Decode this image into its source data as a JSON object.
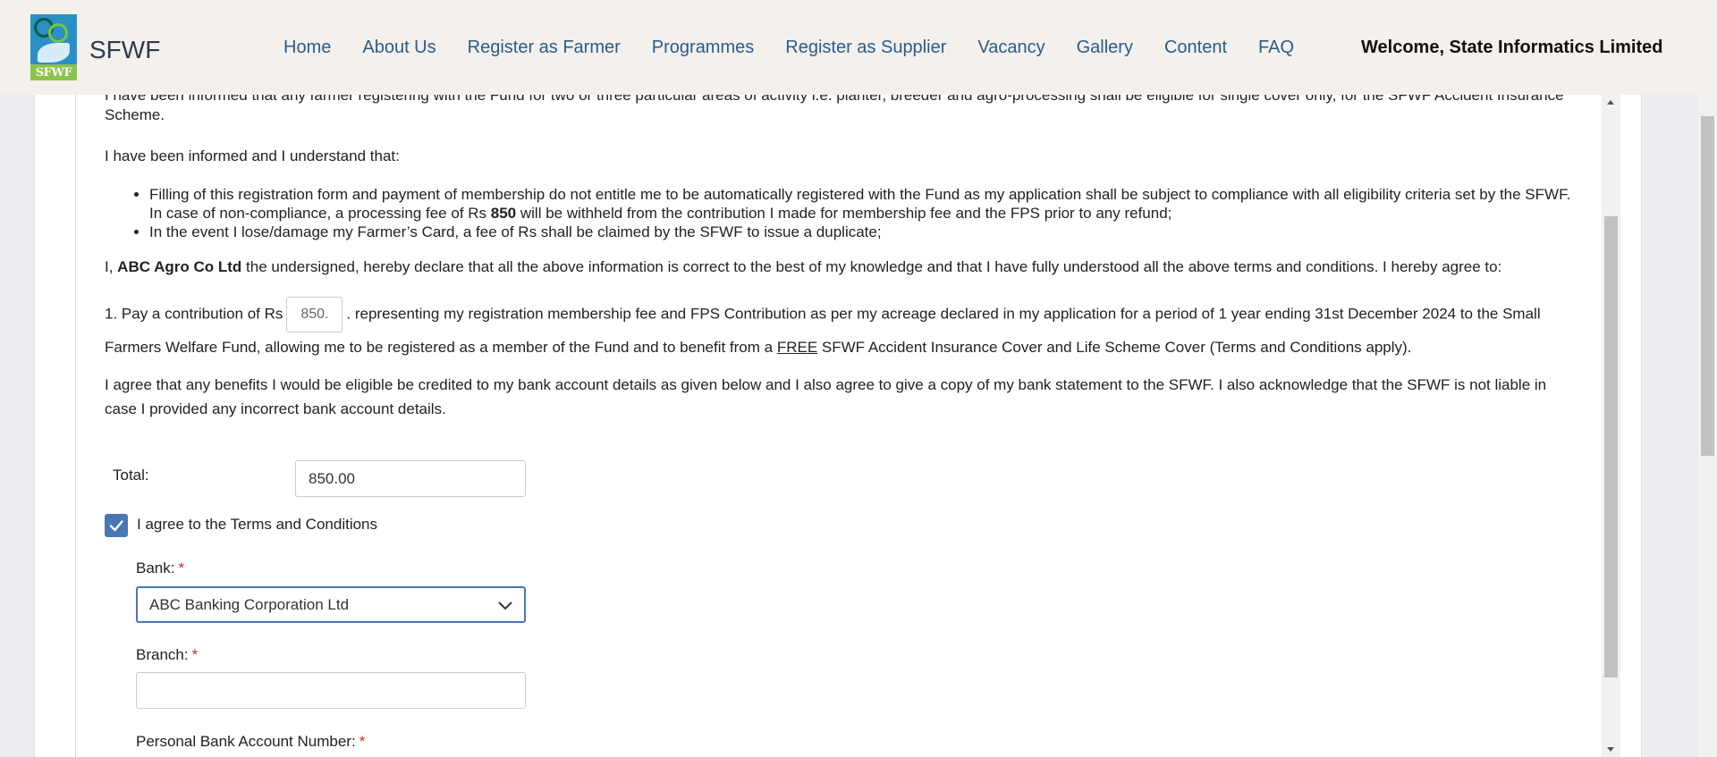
{
  "header": {
    "logo_text": "SFWF",
    "brand": "SFWF",
    "nav": [
      "Home",
      "About Us",
      "Register as Farmer",
      "Programmes",
      "Register as Supplier",
      "Vacancy",
      "Gallery",
      "Content",
      "FAQ"
    ],
    "welcome": "Welcome, State Informatics Limited"
  },
  "form": {
    "top_para": "I have been informed that any farmer registering with the Fund for two or three particular areas of activity i.e. planter, breeder and agro-processing shall be eligible for single cover only, for the SFWF Accident Insurance Scheme.",
    "informed": "I have been informed and I understand that:",
    "bullet1_a": "Filling of this registration form and payment of membership do not entitle me to be automatically registered with the Fund as my application shall be subject to compliance with all eligibility criteria set by the SFWF. In case of non-compliance, a processing fee of Rs ",
    "bullet1_fee": "850",
    "bullet1_b": " will be withheld from the contribution I made for membership fee and the FPS prior to any refund;",
    "bullet2": "In the event I lose/damage my Farmer’s Card, a fee of Rs shall be claimed by the SFWF to issue a duplicate;",
    "decl_a": "I, ",
    "decl_name": "ABC Agro Co Ltd",
    "decl_b": " the undersigned, hereby declare that all the above information is correct to the best of my knowledge and that I have fully understood all the above terms and conditions. I hereby agree to:",
    "pay_a": "1. Pay a contribution of Rs",
    "pay_value": "850.",
    "pay_b": ". representing my registration membership fee and FPS Contribution as per my acreage declared in my application for a period of 1 year ending 31st December 2024 to the Small Farmers Welfare Fund, allowing me to be registered as a member of the Fund and to benefit from a ",
    "pay_free": "FREE",
    "pay_c": " SFWF Accident Insurance Cover and Life Scheme Cover (Terms and Conditions apply).",
    "agree_para": "I agree that any benefits I would be eligible be credited to my bank account details as given below and I also agree to give a copy of my bank statement to the SFWF. I also acknowledge that the SFWF is not liable in case I provided any incorrect bank account details.",
    "total_label": "Total:",
    "total_value": "850.00",
    "terms_label": "I agree to the Terms and Conditions",
    "bank_label": "Bank:",
    "bank_value": "ABC Banking Corporation Ltd",
    "branch_label": "Branch:",
    "branch_value": "",
    "acct_label": "Personal Bank Account Number:",
    "required_mark": "*"
  }
}
